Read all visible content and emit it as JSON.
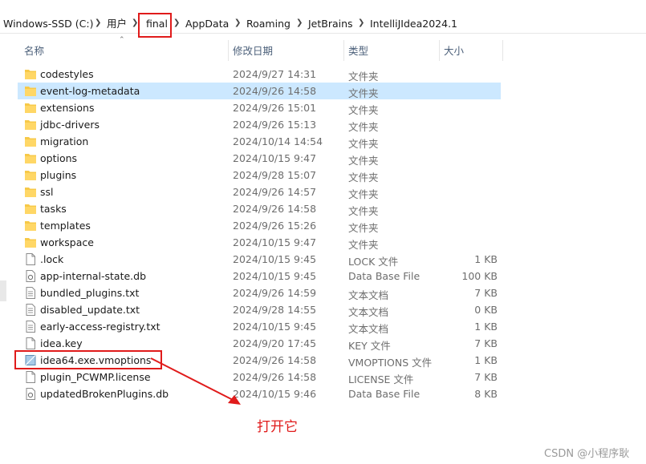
{
  "breadcrumb": [
    "Windows-SSD (C:)",
    "用户",
    "final",
    "AppData",
    "Roaming",
    "JetBrains",
    "IntelliJIdea2024.1"
  ],
  "columns": {
    "name": "名称",
    "modified": "修改日期",
    "type": "类型",
    "size": "大小"
  },
  "files": [
    {
      "name": "codestyles",
      "modified": "2024/9/27 14:31",
      "type": "文件夹",
      "size": "",
      "kind": "folder"
    },
    {
      "name": "event-log-metadata",
      "modified": "2024/9/26 14:58",
      "type": "文件夹",
      "size": "",
      "kind": "folder",
      "selected": true
    },
    {
      "name": "extensions",
      "modified": "2024/9/26 15:01",
      "type": "文件夹",
      "size": "",
      "kind": "folder"
    },
    {
      "name": "jdbc-drivers",
      "modified": "2024/9/26 15:13",
      "type": "文件夹",
      "size": "",
      "kind": "folder"
    },
    {
      "name": "migration",
      "modified": "2024/10/14 14:54",
      "type": "文件夹",
      "size": "",
      "kind": "folder"
    },
    {
      "name": "options",
      "modified": "2024/10/15 9:47",
      "type": "文件夹",
      "size": "",
      "kind": "folder"
    },
    {
      "name": "plugins",
      "modified": "2024/9/28 15:07",
      "type": "文件夹",
      "size": "",
      "kind": "folder"
    },
    {
      "name": "ssl",
      "modified": "2024/9/26 14:57",
      "type": "文件夹",
      "size": "",
      "kind": "folder"
    },
    {
      "name": "tasks",
      "modified": "2024/9/26 14:58",
      "type": "文件夹",
      "size": "",
      "kind": "folder"
    },
    {
      "name": "templates",
      "modified": "2024/9/26 15:26",
      "type": "文件夹",
      "size": "",
      "kind": "folder"
    },
    {
      "name": "workspace",
      "modified": "2024/10/15 9:47",
      "type": "文件夹",
      "size": "",
      "kind": "folder"
    },
    {
      "name": ".lock",
      "modified": "2024/10/15 9:45",
      "type": "LOCK 文件",
      "size": "1 KB",
      "kind": "file"
    },
    {
      "name": "app-internal-state.db",
      "modified": "2024/10/15 9:45",
      "type": "Data Base File",
      "size": "100 KB",
      "kind": "db"
    },
    {
      "name": "bundled_plugins.txt",
      "modified": "2024/9/26 14:59",
      "type": "文本文档",
      "size": "7 KB",
      "kind": "text"
    },
    {
      "name": "disabled_update.txt",
      "modified": "2024/9/28 14:55",
      "type": "文本文档",
      "size": "0 KB",
      "kind": "text"
    },
    {
      "name": "early-access-registry.txt",
      "modified": "2024/10/15 9:45",
      "type": "文本文档",
      "size": "1 KB",
      "kind": "text"
    },
    {
      "name": "idea.key",
      "modified": "2024/9/20 17:45",
      "type": "KEY 文件",
      "size": "7 KB",
      "kind": "file"
    },
    {
      "name": "idea64.exe.vmoptions",
      "modified": "2024/9/26 14:58",
      "type": "VMOPTIONS 文件",
      "size": "1 KB",
      "kind": "vmoptions"
    },
    {
      "name": "plugin_PCWMP.license",
      "modified": "2024/9/26 14:58",
      "type": "LICENSE 文件",
      "size": "7 KB",
      "kind": "file"
    },
    {
      "name": "updatedBrokenPlugins.db",
      "modified": "2024/10/15 9:46",
      "type": "Data Base File",
      "size": "8 KB",
      "kind": "db"
    }
  ],
  "annotation": "打开它",
  "watermark": "CSDN @小程序耿",
  "colors": {
    "selection": "#cce8ff",
    "folder": "#f7c948",
    "annotation_red": "#e01b1b"
  }
}
